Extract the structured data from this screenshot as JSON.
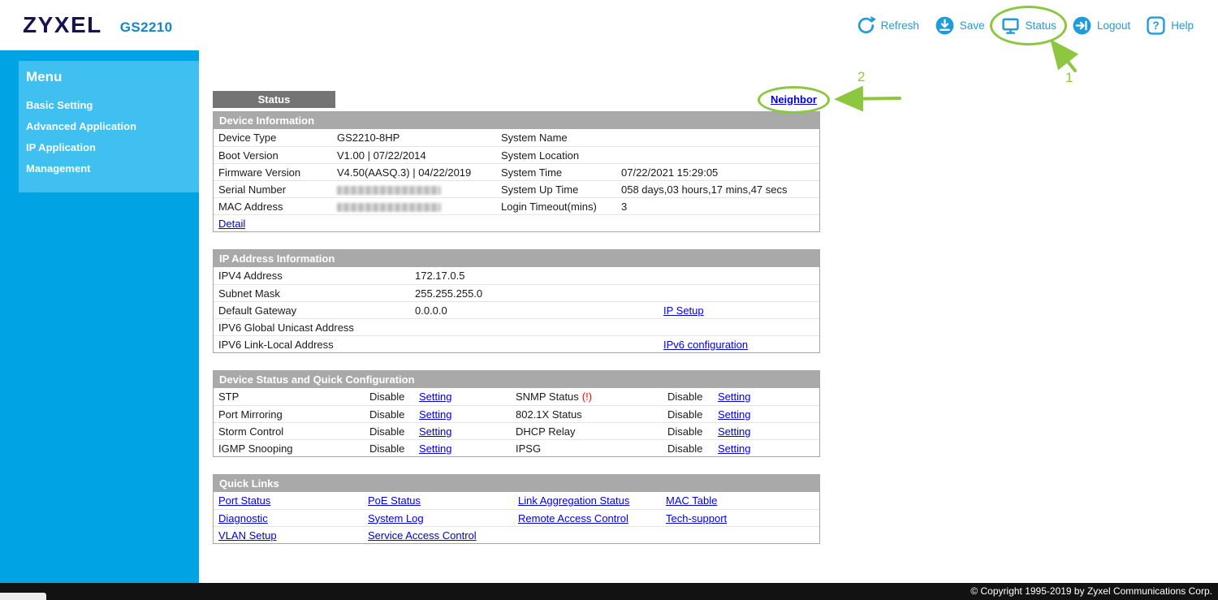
{
  "colors": {
    "accent_blue": "#1f9cd9",
    "sidebar_blue": "#00a3e4",
    "menu_panel_blue": "#3fc0f0",
    "section_header_gray": "#a9a9a9",
    "link_blue": "#0000dd",
    "annotation_green": "#8dc63f",
    "alert_red": "#ff0000"
  },
  "header": {
    "brand": "ZYXEL",
    "model": "GS2210",
    "help_glyph": "?",
    "actions": [
      {
        "label": "Refresh"
      },
      {
        "label": "Save"
      },
      {
        "label": "Status"
      },
      {
        "label": "Logout"
      },
      {
        "label": "Help"
      }
    ]
  },
  "annotations": {
    "step1": "1",
    "step2": "2"
  },
  "sidebar": {
    "title": "Menu",
    "items": [
      "Basic Setting",
      "Advanced Application",
      "IP Application",
      "Management"
    ]
  },
  "main": {
    "tab": "Status",
    "neighbor_link": "Neighbor",
    "device_information": {
      "title": "Device Information",
      "rows": [
        {
          "l_label": "Device Type",
          "l_value": "GS2210-8HP",
          "r_label": "System Name",
          "r_value": ""
        },
        {
          "l_label": "Boot Version",
          "l_value": "V1.00 | 07/22/2014",
          "r_label": "System Location",
          "r_value": ""
        },
        {
          "l_label": "Firmware Version",
          "l_value": "V4.50(AASQ.3) | 04/22/2019",
          "r_label": "System Time",
          "r_value": "07/22/2021 15:29:05"
        },
        {
          "l_label": "Serial Number",
          "l_value": "",
          "redacted": true,
          "r_label": "System Up Time",
          "r_value": "058 days,03 hours,17 mins,47 secs"
        },
        {
          "l_label": "MAC Address",
          "l_value": "",
          "redacted": true,
          "r_label": "Login Timeout(mins)",
          "r_value": "3"
        }
      ],
      "detail_link": "Detail"
    },
    "ip_information": {
      "title": "IP Address Information",
      "rows": [
        {
          "label": "IPV4 Address",
          "value": "172.17.0.5",
          "link": ""
        },
        {
          "label": "Subnet Mask",
          "value": "255.255.255.0",
          "link": ""
        },
        {
          "label": "Default Gateway",
          "value": "0.0.0.0",
          "link": "IP Setup"
        },
        {
          "label": "IPV6 Global Unicast Address",
          "value": "",
          "link": ""
        },
        {
          "label": "IPV6 Link-Local Address",
          "value": "",
          "link": "IPv6 configuration"
        }
      ]
    },
    "device_status": {
      "title": "Device Status and Quick Configuration",
      "rows": [
        {
          "l_name": "STP",
          "l_status": "Disable",
          "l_setting": "Setting",
          "r_name": "SNMP Status",
          "r_alert": "(!)",
          "r_status": "Disable",
          "r_setting": "Setting"
        },
        {
          "l_name": "Port Mirroring",
          "l_status": "Disable",
          "l_setting": "Setting",
          "r_name": "802.1X Status",
          "r_alert": "",
          "r_status": "Disable",
          "r_setting": "Setting"
        },
        {
          "l_name": "Storm Control",
          "l_status": "Disable",
          "l_setting": "Setting",
          "r_name": "DHCP Relay",
          "r_alert": "",
          "r_status": "Disable",
          "r_setting": "Setting"
        },
        {
          "l_name": "IGMP Snooping",
          "l_status": "Disable",
          "l_setting": "Setting",
          "r_name": "IPSG",
          "r_alert": "",
          "r_status": "Disable",
          "r_setting": "Setting"
        }
      ]
    },
    "quick_links": {
      "title": "Quick Links",
      "rows": [
        [
          "Port Status",
          "PoE Status",
          "Link Aggregation Status",
          "MAC Table"
        ],
        [
          "Diagnostic",
          "System Log",
          "Remote Access Control",
          "Tech-support"
        ],
        [
          "VLAN Setup",
          "Service Access Control",
          "",
          ""
        ]
      ]
    }
  },
  "footer": {
    "copyright": "© Copyright 1995-2019 by Zyxel Communications Corp."
  }
}
